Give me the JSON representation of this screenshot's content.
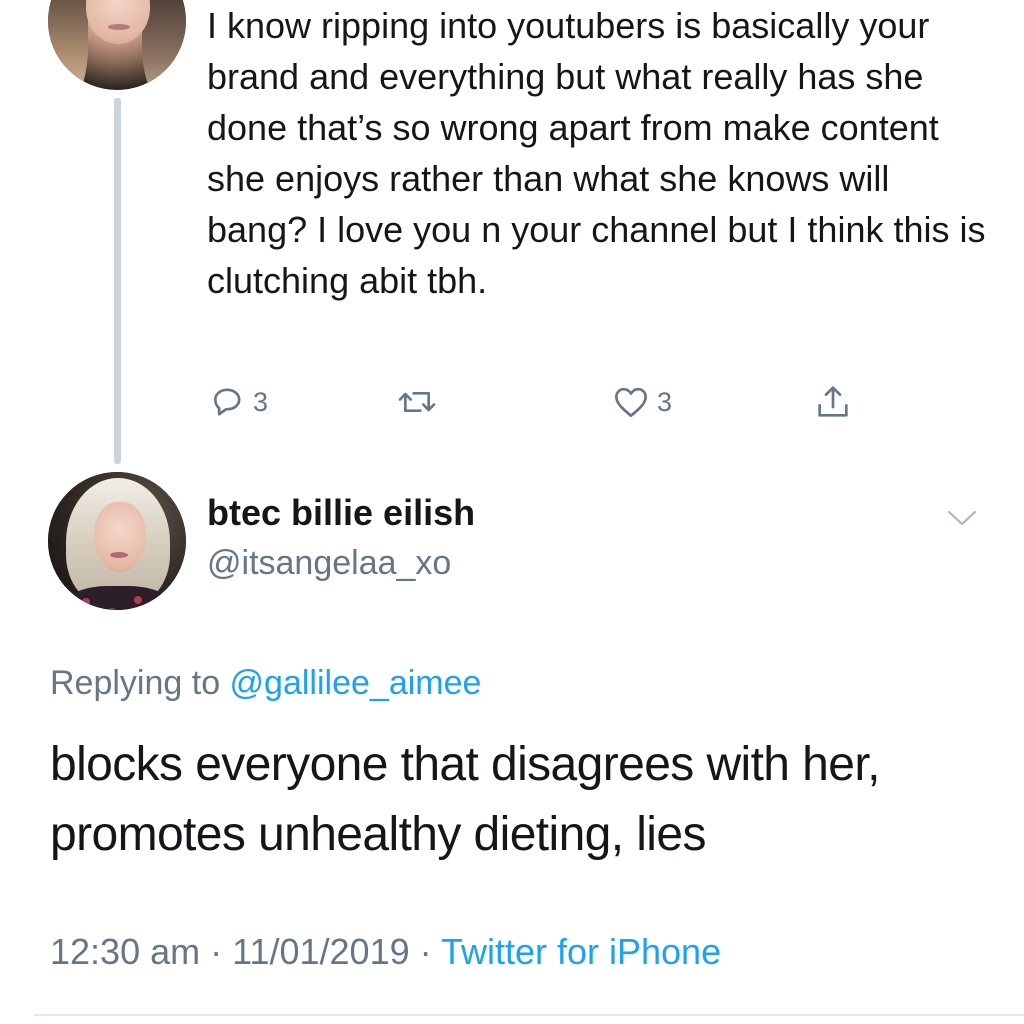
{
  "parent_tweet": {
    "avatar": "profile-photo",
    "text": "I know ripping into youtubers is basically your brand and everything but what really has she done that’s so wrong apart from make content she enjoys rather than what she knows will bang? I love you n your channel but I think this is clutching abit tbh.",
    "actions": {
      "reply": {
        "icon": "reply-icon",
        "count": "3"
      },
      "retweet": {
        "icon": "retweet-icon",
        "count": ""
      },
      "like": {
        "icon": "heart-icon",
        "count": "3"
      },
      "share": {
        "icon": "share-icon"
      }
    }
  },
  "main_tweet": {
    "avatar": "profile-photo",
    "display_name": "btec billie eilish",
    "handle": "@itsangelaa_xo",
    "menu_icon": "chevron-down-icon",
    "replying_prefix": "Replying to ",
    "replying_to": "@gallilee_aimee",
    "text": "blocks everyone that disagrees with her, promotes unhealthy dieting, lies",
    "time": "12:30 am",
    "separator": " · ",
    "date": "11/01/2019",
    "source": "Twitter for iPhone"
  },
  "colors": {
    "text": "#14171a",
    "secondary": "#657786",
    "link": "#1da1f2",
    "thread_line": "#cdd5dc",
    "divider": "#e1e8ed"
  }
}
